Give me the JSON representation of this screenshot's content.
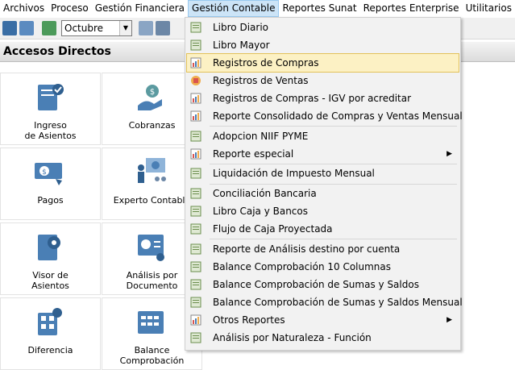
{
  "menubar": [
    "Archivos",
    "Proceso",
    "Gestión Financiera",
    "Gestión Contable",
    "Reportes Sunat",
    "Reportes Enterprise",
    "Utilitarios",
    "?"
  ],
  "toolbar": {
    "period_value": "Octubre"
  },
  "panel": {
    "title": "Accesos Directos"
  },
  "tiles": [
    "Ingreso\nde Asientos",
    "Cobranzas",
    "Pagos",
    "Experto Contable",
    "Visor de\nAsientos",
    "Análisis por\nDocumento",
    "Diferencia",
    "Balance Comprobación"
  ],
  "dropdown": {
    "items": [
      "Libro Diario",
      "Libro Mayor",
      "Registros de Compras",
      "Registros de Ventas",
      "Registros de Compras - IGV por acreditar",
      "Reporte Consolidado de Compras y Ventas Mensual",
      "Adopcion NIIF PYME",
      "Reporte especial",
      "Liquidación de Impuesto Mensual",
      "Conciliación Bancaria",
      "Libro Caja y Bancos",
      "Flujo de Caja Proyectada",
      "Reporte de Análisis destino por cuenta",
      "Balance Comprobación 10 Columnas",
      "Balance Comprobación de Sumas y Saldos",
      "Balance Comprobación de Sumas y Saldos Mensual",
      "Otros Reportes",
      "Análisis por Naturaleza - Función"
    ],
    "highlighted": "Registros de Compras"
  },
  "colors": {
    "highlight": "#fcf1c4",
    "icon_blue": "#4a7fb5",
    "icon_teal": "#5b9aa0"
  }
}
